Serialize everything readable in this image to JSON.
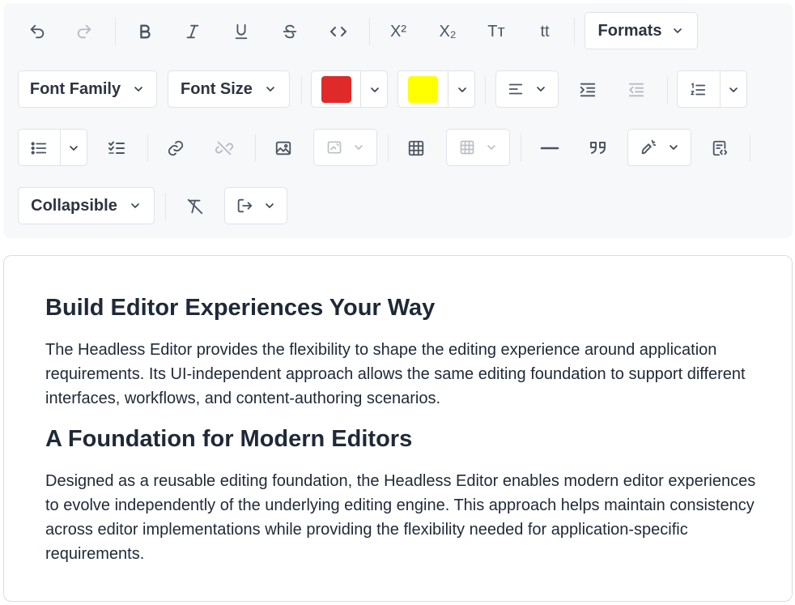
{
  "toolbar": {
    "formats_label": "Formats",
    "font_family_label": "Font Family",
    "font_size_label": "Font Size",
    "collapsible_label": "Collapsible",
    "superscript_glyph": "X²",
    "subscript_glyph": "X₂",
    "uppercase_glyph": "Tт",
    "lowercase_glyph": "tt",
    "text_color": "#e02a2a",
    "highlight_color": "#ffff00"
  },
  "editor": {
    "heading1": "Build Editor Experiences Your Way",
    "paragraph1": "The Headless Editor provides the flexibility to shape the editing experience around application requirements. Its UI-independent approach allows the same editing foundation to support different interfaces, workflows, and content-authoring scenarios.",
    "heading2": "A Foundation for Modern Editors",
    "paragraph2": "Designed as a reusable editing foundation, the Headless Editor enables modern editor experiences to evolve independently of the underlying editing engine. This approach helps maintain consistency across editor implementations while providing the flexibility needed for application-specific requirements."
  }
}
